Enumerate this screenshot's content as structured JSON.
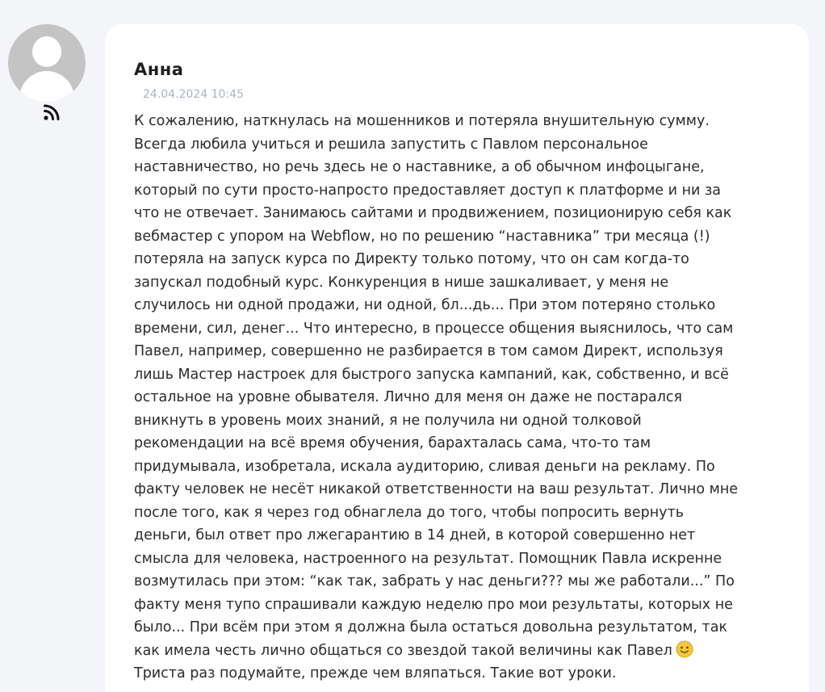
{
  "comment": {
    "author": "Анна",
    "date": "24.04.2024 10:45",
    "lines": [
      "К сожалению, наткнулась на мошенников и потеряла внушительную сумму.",
      "Всегда любила учиться и решила запустить с Павлом персональное",
      "наставничество, но речь здесь не о наставнике, а об обычном инфоцыгане,",
      "который по сути просто-напросто предоставляет доступ к платформе и ни за",
      "что не отвечает. Занимаюсь сайтами и продвижением, позиционирую себя как",
      "вебмастер с упором на Webflow, но по решению “наставника” три месяца (!)",
      "потеряла на запуск курса по Директу только потому, что он сам когда-то",
      "запускал подобный курс. Конкуренция в нише зашкаливает, у меня не",
      "случилось ни одной продажи, ни одной, бл...дь... При этом потеряно столько",
      "времени, сил, денег... Что интересно, в процессе общения выяснилось, что сам",
      "Павел, например, совершенно не разбирается в том самом Директ, используя",
      "лишь Мастер настроек для быстрого запуска кампаний, как, собственно, и всё",
      "остальное на уровне обывателя. Лично для меня он даже не постарался",
      "вникнуть в уровень моих знаний, я не получила ни одной толковой",
      "рекомендации на всё время обучения, барахталась сама, что-то там",
      "придумывала, изобретала, искала аудиторию, сливая деньги на рекламу. По",
      "факту человек не несёт никакой ответственности на ваш результат. Лично мне",
      "после того, как я через год обнаглела до того, чтобы попросить вернуть",
      "деньги, был ответ про лжегарантию в 14 дней, в которой совершенно нет",
      "смысла для человека, настроенного на результат. Помощник Павла искренне",
      "возмутилась при этом: “как так, забрать у нас деньги??? мы же работали...” По",
      "факту меня тупо спрашивали каждую неделю про мои результаты, которых не",
      "было... При всём при этом я должна была остаться довольна результатом, так",
      "как имела честь лично общаться со звездой такой величины как Павел",
      "Триста раз подумайте, прежде чем вляпаться. Такие вот уроки."
    ]
  },
  "icons": {
    "avatar": "user-avatar-placeholder",
    "rss": "rss-icon",
    "emoji": "smiling-face-emoji"
  },
  "colors": {
    "background": "#f4f5f8",
    "card": "#ffffff",
    "date": "#a8b4c4",
    "text": "#2b2b2b"
  }
}
